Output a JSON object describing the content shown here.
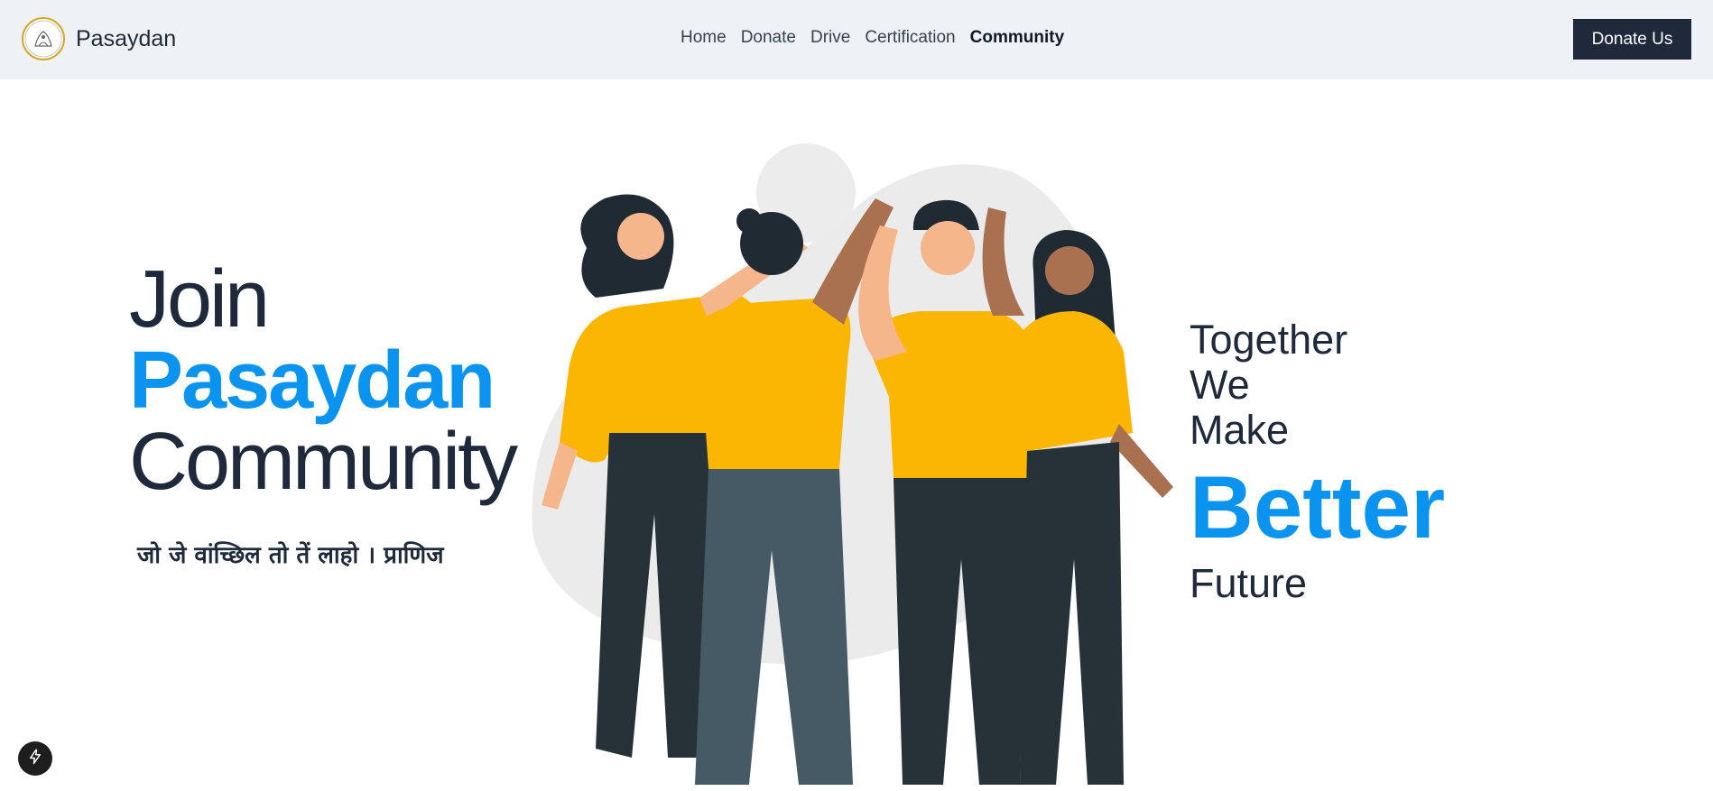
{
  "nav": {
    "brand": "Pasaydan",
    "logo_text": "PASAYDAN",
    "links": [
      {
        "label": "Home",
        "active": false
      },
      {
        "label": "Donate",
        "active": false
      },
      {
        "label": "Drive",
        "active": false
      },
      {
        "label": "Certification",
        "active": false
      },
      {
        "label": "Community",
        "active": true
      }
    ],
    "cta": "Donate Us"
  },
  "hero": {
    "line1": "Join",
    "line2": "Pasaydan",
    "line3": "Community",
    "tagline": "जो जे वांच्छिल तो तें लाहो । प्राणिज"
  },
  "right": {
    "line1": "Together",
    "line2": "We",
    "line3": "Make",
    "highlight": "Better",
    "line4": "Future"
  },
  "colors": {
    "accent": "#0b93f0",
    "dark": "#1e293b",
    "navbar_bg": "#eff2f5",
    "shirt": "#fbb604",
    "pants": "#263238"
  },
  "icons": {
    "fab": "lightning-icon"
  }
}
